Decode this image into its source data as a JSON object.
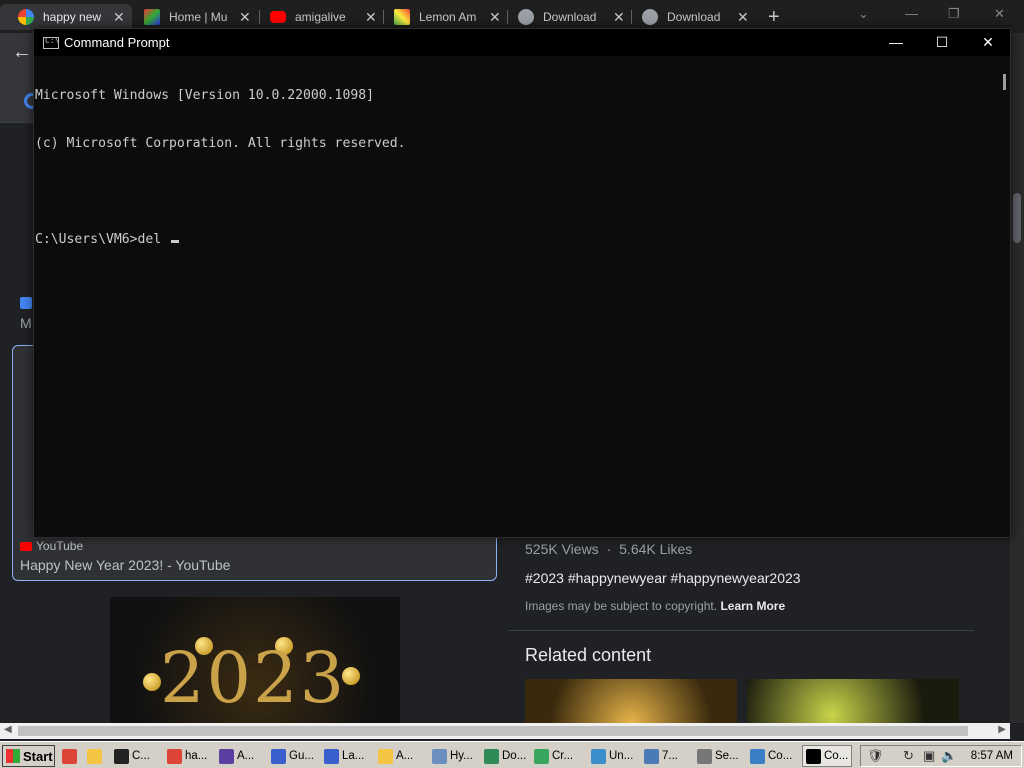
{
  "browser": {
    "tabs": [
      {
        "label": "happy new",
        "active": true,
        "favicon": "google-icon"
      },
      {
        "label": "Home | Mu",
        "active": false,
        "favicon": "site-icon"
      },
      {
        "label": "amigalive",
        "active": false,
        "favicon": "youtube-icon"
      },
      {
        "label": "Lemon Am",
        "active": false,
        "favicon": "lemon-icon"
      },
      {
        "label": "Download",
        "active": false,
        "favicon": "globe-icon"
      },
      {
        "label": "Download",
        "active": false,
        "favicon": "globe-icon"
      }
    ],
    "new_tab": "+",
    "back": "←"
  },
  "page": {
    "side_letter": "M",
    "result_source": "YouTube",
    "result_title": "Happy New Year 2023! - YouTube",
    "thumb_text": "2023",
    "views": "525K Views",
    "sep": "·",
    "likes": "5.64K Likes",
    "tags": "#2023 #happynewyear #happynewyear2023",
    "copyright_text": "Images may be subject to copyright.",
    "learn_more": "Learn More",
    "related_heading": "Related content"
  },
  "cmd": {
    "title": "Command Prompt",
    "icon_text": "C:\\",
    "minimize": "—",
    "maximize": "☐",
    "close": "✕",
    "lines": [
      "Microsoft Windows [Version 10.0.22000.1098]",
      "(c) Microsoft Corporation. All rights reserved.",
      "",
      "C:\\Users\\VM6>del "
    ]
  },
  "taskbar": {
    "start": "Start",
    "items": [
      {
        "label": "",
        "icon": "chrome-icon",
        "color": "#db4437"
      },
      {
        "label": "",
        "icon": "folder-icon",
        "color": "#f4c542"
      },
      {
        "label": "C...",
        "icon": "7zip-icon",
        "color": "#222222"
      },
      {
        "label": "ha...",
        "icon": "chrome-icon",
        "color": "#db4437"
      },
      {
        "label": "A...",
        "icon": "app-icon",
        "color": "#5b3fa0"
      },
      {
        "label": "Gu...",
        "icon": "notepad-icon",
        "color": "#3a5fcd"
      },
      {
        "label": "La...",
        "icon": "notepad-icon",
        "color": "#3a5fcd"
      },
      {
        "label": "A...",
        "icon": "folder-icon",
        "color": "#f4c542"
      },
      {
        "label": "Hy...",
        "icon": "doc-icon",
        "color": "#6a8fbf"
      },
      {
        "label": "Do...",
        "icon": "download-icon",
        "color": "#2e8b57"
      },
      {
        "label": "Cr...",
        "icon": "doc-icon",
        "color": "#3aa55d"
      },
      {
        "label": "Un...",
        "icon": "gear-icon",
        "color": "#3b8ec9"
      },
      {
        "label": "7...",
        "icon": "computer-icon",
        "color": "#4a7bb7"
      },
      {
        "label": "Se...",
        "icon": "settings-icon",
        "color": "#777777"
      },
      {
        "label": "Co...",
        "icon": "control-icon",
        "color": "#3a7fc4"
      },
      {
        "label": "Co...",
        "icon": "cmd-icon",
        "color": "#000000",
        "active": true
      }
    ],
    "clock": "8:57 AM"
  }
}
